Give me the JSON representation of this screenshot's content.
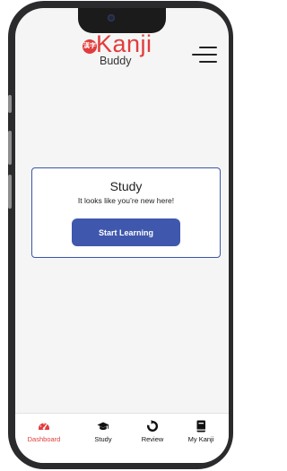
{
  "header": {
    "logo_badge": "漢字",
    "logo_title": "Kanji",
    "logo_subtitle": "Buddy",
    "menu_icon": "hamburger-icon"
  },
  "card": {
    "title": "Study",
    "subtitle": "It looks like you’re new here!",
    "button_label": "Start Learning"
  },
  "nav": {
    "items": [
      {
        "label": "Dashboard",
        "icon": "gauge-icon",
        "active": true
      },
      {
        "label": "Study",
        "icon": "graduation-cap-icon",
        "active": false
      },
      {
        "label": "Review",
        "icon": "refresh-icon",
        "active": false
      },
      {
        "label": "My Kanji",
        "icon": "book-icon",
        "active": false
      }
    ]
  },
  "colors": {
    "accent": "#e23c3c",
    "primary": "#3f58ad",
    "card_border": "#3b55a6",
    "frame": "#2b2b2d",
    "screen_bg": "#f5f5f5"
  }
}
